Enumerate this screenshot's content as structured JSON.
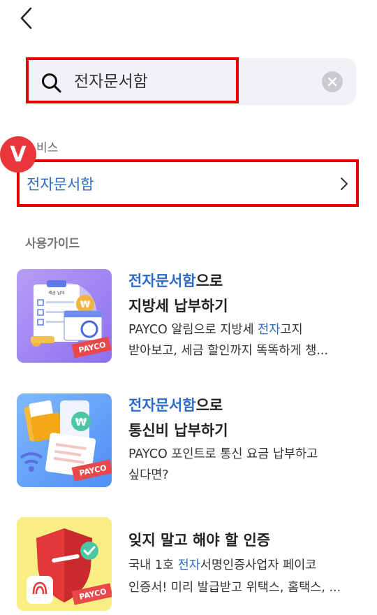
{
  "search": {
    "query": "전자문서함"
  },
  "service_section": {
    "label": "비스",
    "badge": "V",
    "item_label": "전자문서함"
  },
  "guide_section": {
    "label": "사용가이드"
  },
  "guides": [
    {
      "title_highlight": "전자문서함",
      "title_rest": "으로",
      "title_line2": "지방세 납부하기",
      "desc_line1": "PAYCO 알림으로 지방세 ",
      "desc_line1_highlight": "전자",
      "desc_line1_rest": "고지",
      "desc_line2": "받아보고, 세금 할인까지 똑똑하게 챙...",
      "thumb_brand": "PAYCO",
      "thumb_doc_title": "세금 납부"
    },
    {
      "title_highlight": "전자문서함",
      "title_rest": "으로",
      "title_line2": "통신비 납부하기",
      "desc_line1": "PAYCO 포인트로 통신 요금 납부하고",
      "desc_line2": "싶다면?",
      "thumb_brand": "PAYCO"
    },
    {
      "title": "잊지 말고 해야 할 인증",
      "desc_line1": "국내 1호 ",
      "desc_line1_highlight": "전자",
      "desc_line1_rest": "서명인증사업자 페이코",
      "desc_line2": "인증서! 미리 발급받고 위택스, 홈택스, ...",
      "thumb_brand": "PAYCO"
    }
  ],
  "colors": {
    "highlight_box": "#e60000",
    "link_blue": "#2c6bc9",
    "badge_red": "#e8363a"
  }
}
